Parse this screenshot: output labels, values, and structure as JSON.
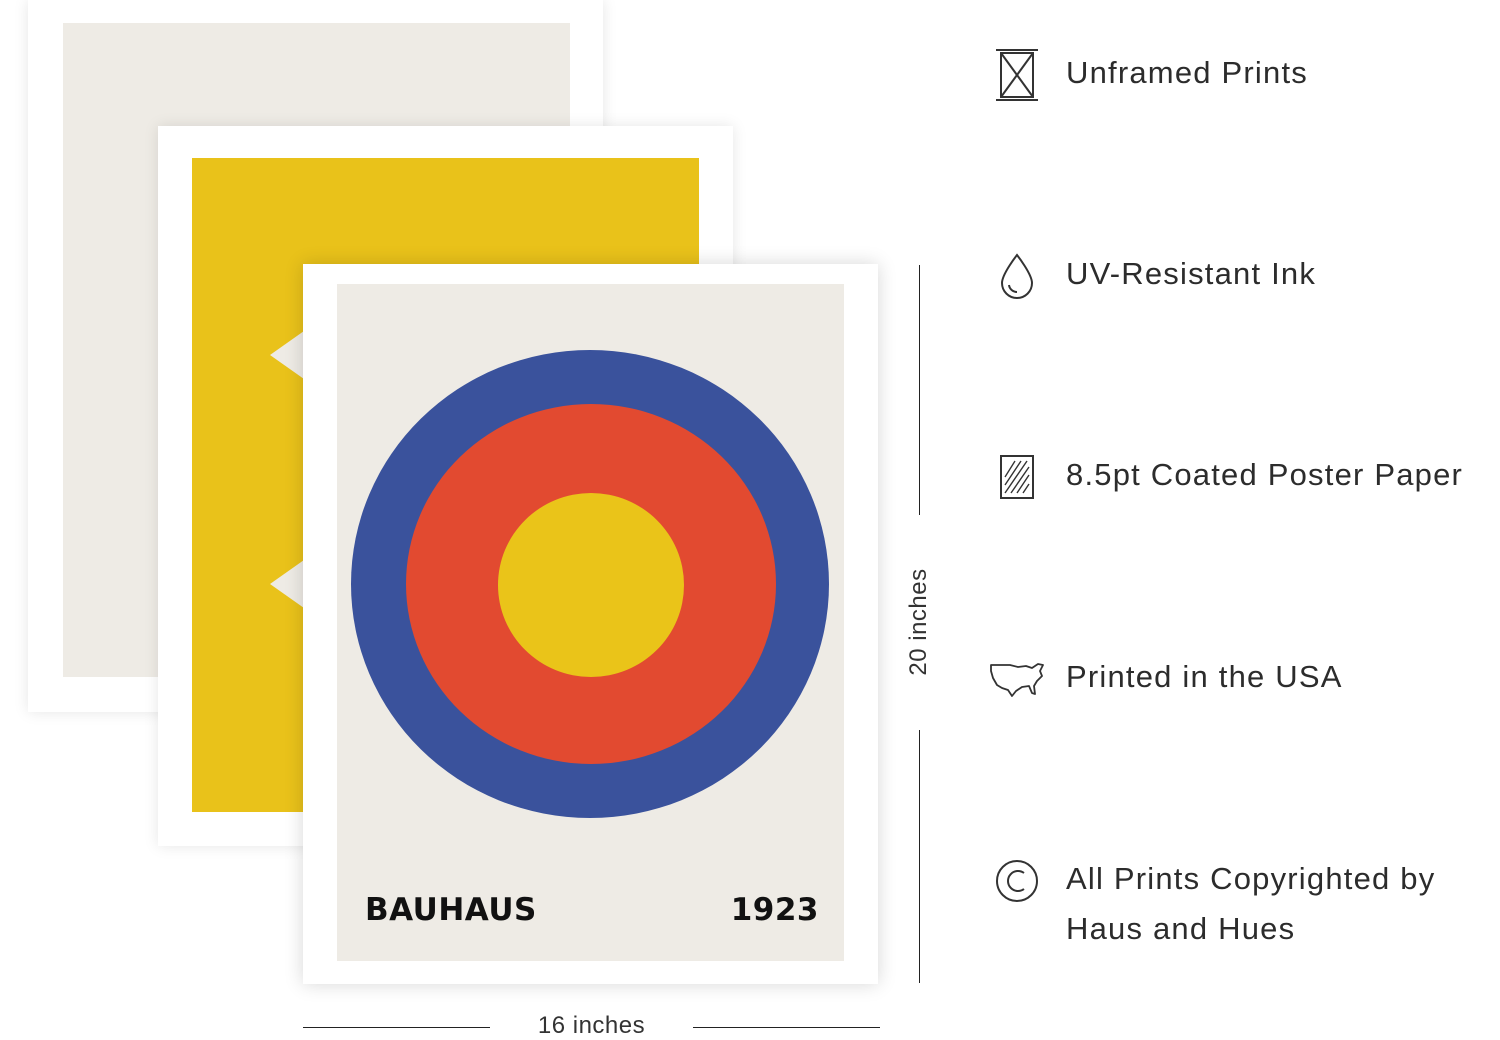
{
  "poster": {
    "title": "BAUHAUS",
    "year": "1923"
  },
  "dimensions": {
    "width_label": "16 inches",
    "height_label": "20 inches"
  },
  "features": [
    {
      "icon": "unframed-box-icon",
      "text": "Unframed Prints"
    },
    {
      "icon": "ink-drop-icon",
      "text": "UV-Resistant Ink"
    },
    {
      "icon": "paper-sheet-icon",
      "text": "8.5pt Coated Poster Paper"
    },
    {
      "icon": "usa-map-icon",
      "text": "Printed in the USA"
    },
    {
      "icon": "copyright-icon",
      "text": "All Prints Copyrighted by Haus and Hues"
    }
  ],
  "colors": {
    "blue": "#3a529c",
    "red": "#e24a30",
    "yellow": "#eac419",
    "cream": "#eeebe5"
  }
}
